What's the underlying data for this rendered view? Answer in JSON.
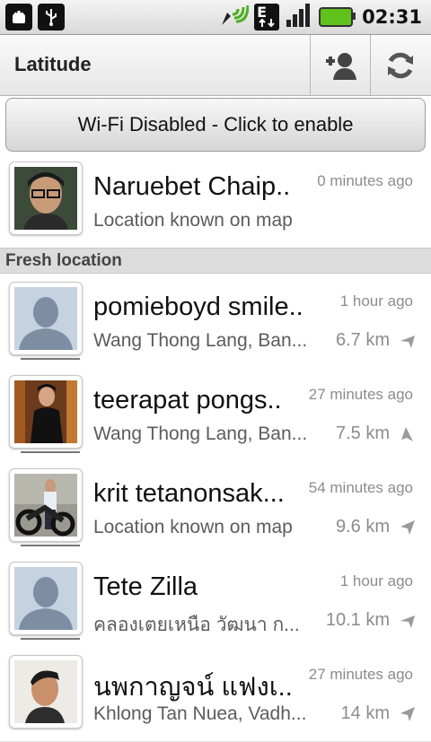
{
  "status_bar": {
    "time": "02:31",
    "icons": [
      "android-debug-icon",
      "usb-icon",
      "gps-signal-icon",
      "data-updown-icon",
      "signal-bars-icon",
      "battery-charging-icon"
    ],
    "network_label": "E"
  },
  "header": {
    "title": "Latitude",
    "add_friend_icon": "add-person-icon",
    "refresh_icon": "refresh-icon"
  },
  "wifi_banner": {
    "label": "Wi-Fi Disabled - Click to enable"
  },
  "me": {
    "name": "Naruebet Chaip..",
    "time_ago": "0 minutes ago",
    "location": "Location known on map"
  },
  "section_label": "Fresh location",
  "friends": [
    {
      "name": "pomieboyd smile...",
      "time_ago": "1 hour ago",
      "location": "Wang Thong Lang, Ban...",
      "distance": "6.7 km"
    },
    {
      "name": "teerapat pongs..",
      "time_ago": "27 minutes ago",
      "location": "Wang Thong Lang, Ban...",
      "distance": "7.5 km"
    },
    {
      "name": "krit tetanonsak...",
      "time_ago": "54 minutes ago",
      "location": "Location known on map",
      "distance": "9.6 km"
    },
    {
      "name": "Tete Zilla",
      "time_ago": "1 hour ago",
      "location": "คลองเตยเหนือ วัฒนา ก...",
      "distance": "10.1 km"
    },
    {
      "name": "นพกาญจน์ แฟงเ..",
      "time_ago": "27 minutes ago",
      "location": "Khlong Tan Nuea, Vadh...",
      "distance": "14 km"
    }
  ],
  "colors": {
    "battery": "#5fc21b",
    "section_bg": "#dcdcdc",
    "meta_text": "#8c8c8c"
  }
}
